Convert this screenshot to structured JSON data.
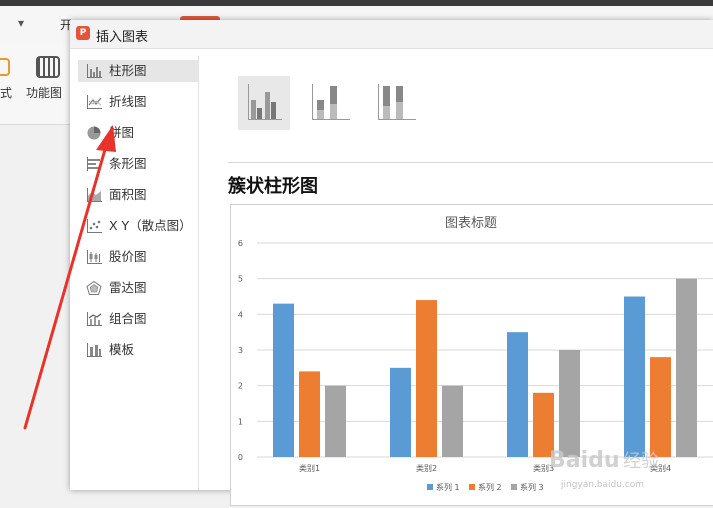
{
  "background": {
    "tab_char": "开",
    "ribbon_left_label": "式",
    "ribbon_function_label": "功能图",
    "chevron": "▾"
  },
  "dialog": {
    "title": "插入图表",
    "app_icon_letter": "P"
  },
  "categories": [
    {
      "label": "柱形图",
      "icon": "column-chart-icon",
      "selected": true
    },
    {
      "label": "折线图",
      "icon": "line-chart-icon",
      "selected": false
    },
    {
      "label": "饼图",
      "icon": "pie-chart-icon",
      "selected": false
    },
    {
      "label": "条形图",
      "icon": "bar-chart-icon",
      "selected": false
    },
    {
      "label": "面积图",
      "icon": "area-chart-icon",
      "selected": false
    },
    {
      "label": "X Y（散点图）",
      "icon": "scatter-chart-icon",
      "selected": false
    },
    {
      "label": "股价图",
      "icon": "stock-chart-icon",
      "selected": false
    },
    {
      "label": "雷达图",
      "icon": "radar-chart-icon",
      "selected": false
    },
    {
      "label": "组合图",
      "icon": "combo-chart-icon",
      "selected": false
    },
    {
      "label": "模板",
      "icon": "template-icon",
      "selected": false
    }
  ],
  "subtype_title": "簇状柱形图",
  "variants": [
    {
      "name": "clustered-column",
      "selected": true
    },
    {
      "name": "stacked-column",
      "selected": false
    },
    {
      "name": "percent-stacked-column",
      "selected": false
    }
  ],
  "chart_data": {
    "type": "bar",
    "title": "图表标题",
    "categories": [
      "类别1",
      "类别2",
      "类别3",
      "类别4"
    ],
    "series": [
      {
        "name": "系列 1",
        "values": [
          4.3,
          2.5,
          3.5,
          4.5
        ],
        "color": "#5b9bd5"
      },
      {
        "name": "系列 2",
        "values": [
          2.4,
          4.4,
          1.8,
          2.8
        ],
        "color": "#ed7d31"
      },
      {
        "name": "系列 3",
        "values": [
          2.0,
          2.0,
          3.0,
          5.0
        ],
        "color": "#a5a5a5"
      }
    ],
    "ylim": [
      0,
      6
    ],
    "yticks": [
      0,
      1,
      2,
      3,
      4,
      5,
      6
    ],
    "grid": true,
    "legend": "bottom"
  },
  "watermark": {
    "brand": "Baidu",
    "brand_cn": "经验",
    "url": "jingyan.baidu.com"
  },
  "annotation": {
    "arrow_color": "#e8332a"
  }
}
